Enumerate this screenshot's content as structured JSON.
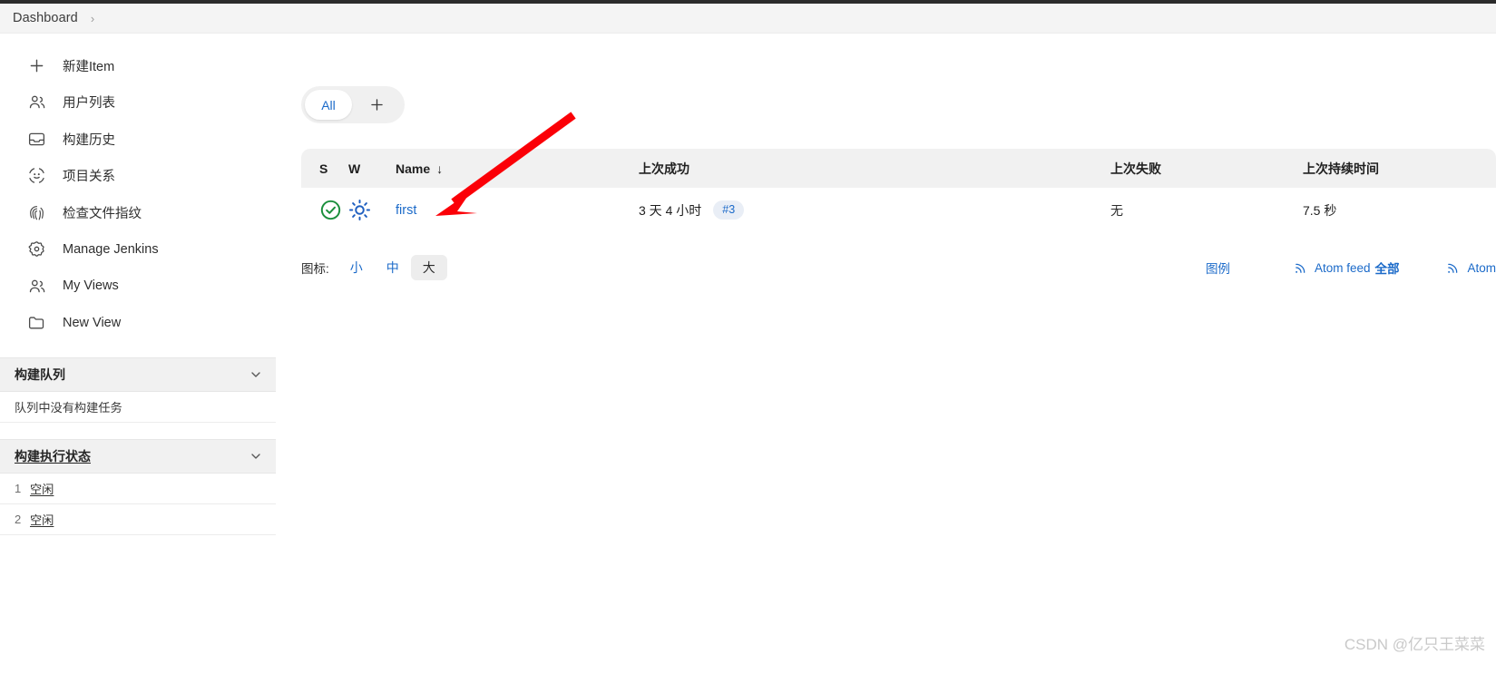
{
  "breadcrumb": {
    "root": "Dashboard",
    "separator": "›"
  },
  "sidebar": {
    "items": [
      {
        "label": "新建Item",
        "icon": "plus-icon"
      },
      {
        "label": "用户列表",
        "icon": "people-icon"
      },
      {
        "label": "构建历史",
        "icon": "inbox-icon"
      },
      {
        "label": "项目关系",
        "icon": "relations-icon"
      },
      {
        "label": "检查文件指纹",
        "icon": "fingerprint-icon"
      },
      {
        "label": "Manage Jenkins",
        "icon": "gear-icon"
      },
      {
        "label": "My Views",
        "icon": "people-icon"
      },
      {
        "label": "New View",
        "icon": "folder-icon"
      }
    ],
    "build_queue": {
      "title": "构建队列",
      "empty_text": "队列中没有构建任务"
    },
    "build_executor": {
      "title": "构建执行状态",
      "executors": [
        {
          "num": "1",
          "state": "空闲"
        },
        {
          "num": "2",
          "state": "空闲"
        }
      ]
    }
  },
  "main": {
    "tabs": [
      {
        "label": "All",
        "active": true
      }
    ],
    "add_tab_icon": "plus-icon",
    "table": {
      "columns": [
        {
          "key": "s",
          "label": "S"
        },
        {
          "key": "w",
          "label": "W"
        },
        {
          "key": "name",
          "label": "Name",
          "sort": "↓"
        },
        {
          "key": "last_success",
          "label": "上次成功"
        },
        {
          "key": "last_failure",
          "label": "上次失败"
        },
        {
          "key": "duration",
          "label": "上次持续时间"
        }
      ],
      "rows": [
        {
          "status_icon": "success-check-icon",
          "weather_icon": "sunny-weather-icon",
          "name": "first",
          "last_success": "3 天 4 小时",
          "last_success_build": "#3",
          "last_failure": "无",
          "duration": "7.5 秒"
        }
      ]
    },
    "footer": {
      "icon_size_label": "图标:",
      "sizes": [
        {
          "label": "小",
          "active": false
        },
        {
          "label": "中",
          "active": false
        },
        {
          "label": "大",
          "active": true
        }
      ],
      "legend_label": "图例",
      "feeds": [
        {
          "text": "Atom feed",
          "scope": "全部"
        },
        {
          "text": "Atom",
          "scope": ""
        }
      ]
    }
  },
  "watermark": "CSDN @亿只王菜菜",
  "colors": {
    "link": "#1b6ac9",
    "success": "#1a8f3c",
    "weather": "#1f5fc0",
    "annotation": "#fb0007",
    "header_bg": "#f1f1f1"
  }
}
